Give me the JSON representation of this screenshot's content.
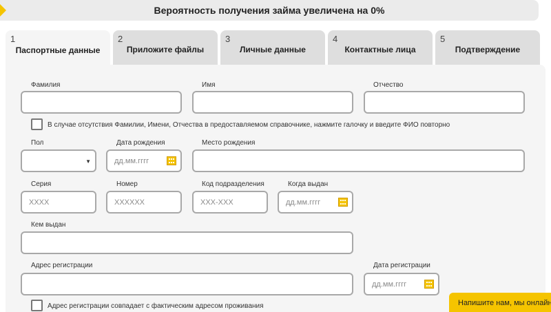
{
  "banner": {
    "text": "Вероятность получения займа увеличена на 0%"
  },
  "tabs": [
    {
      "num": "1",
      "label": "Паспортные данные"
    },
    {
      "num": "2",
      "label": "Приложите файлы"
    },
    {
      "num": "3",
      "label": "Личные данные"
    },
    {
      "num": "4",
      "label": "Контактные лица"
    },
    {
      "num": "5",
      "label": "Подтверждение"
    }
  ],
  "form": {
    "last_name_label": "Фамилия",
    "first_name_label": "Имя",
    "middle_name_label": "Отчество",
    "no_name_checkbox_label": "В случае отсутствия Фамилии, Имени, Отчества в предоставляемом справочнике, нажмите галочку и введите ФИО повторно",
    "gender_label": "Пол",
    "birth_date_label": "Дата рождения",
    "birth_date_placeholder": "дд.мм.гггг",
    "birth_place_label": "Место рождения",
    "series_label": "Серия",
    "series_placeholder": "XXXX",
    "number_label": "Номер",
    "number_placeholder": "XXXXXX",
    "division_code_label": "Код подразделения",
    "division_code_placeholder": "XXX-XXX",
    "issue_date_label": "Когда выдан",
    "issue_date_placeholder": "дд.мм.гггг",
    "issued_by_label": "Кем выдан",
    "reg_address_label": "Адрес регистрации",
    "reg_date_label": "Дата регистрации",
    "reg_date_placeholder": "дд.мм.гггг",
    "same_address_checkbox_label": "Адрес регистрации совпадает с фактическим адресом проживания"
  },
  "chat": {
    "label": "Напишите нам, мы онлайн!"
  },
  "colors": {
    "accent": "#f5c400",
    "tab_inactive": "#dedede",
    "panel": "#f5f5f5"
  }
}
